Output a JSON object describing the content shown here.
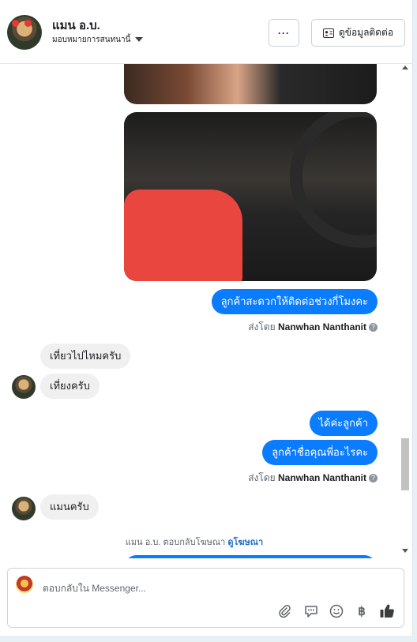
{
  "header": {
    "name": "แมน อ.บ.",
    "assigned": "มอบหมายการสนทนานี้",
    "more_label": "···",
    "contact_label": "ดูข้อมูลติดต่อ"
  },
  "messages": {
    "out1": "ลูกค้าสะดวกให้ติดต่อช่วงกี่โมงคะ",
    "sent1_prefix": "ส่งโดย",
    "sent1_name": "Nanwhan Nanthanit",
    "in1": "เที่ยวไปไหมครับ",
    "in2": "เที่ยงครับ",
    "out2": "ได้ค่ะลูกค้า",
    "out3": "ลูกค้าชื่อคุณพี่อะไรคะ",
    "sent2_prefix": "ส่งโดย",
    "sent2_name": "Nanwhan Nanthanit",
    "in3": "แมนครับ",
    "system_text": "แมน อ.บ. ตอบกลับโฆษณา",
    "system_link": "ดูโฆษณา"
  },
  "composer": {
    "placeholder": "ตอบกลับใน Messenger..."
  },
  "icons": [
    "paperclip-icon",
    "message-icon",
    "emoji-icon",
    "baht-icon",
    "thumbs-up-icon"
  ],
  "colors": {
    "accent": "#0a7cff",
    "incoming_bubble": "#f0f0f0"
  }
}
